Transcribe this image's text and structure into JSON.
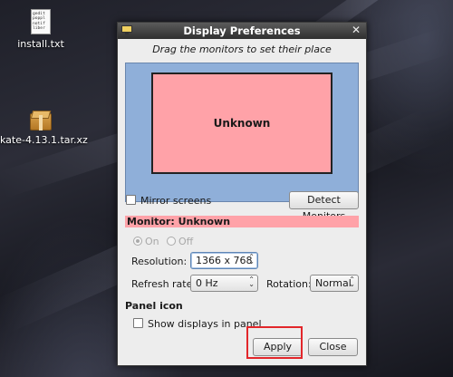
{
  "desktop": {
    "icons": [
      {
        "label": "install.txt",
        "preview_lines": [
          "gedit",
          "poppl",
          "notif",
          "liber"
        ]
      },
      {
        "label": "kate-4.13.1.tar.xz"
      }
    ]
  },
  "window": {
    "title": "Display Preferences",
    "subtitle": "Drag the monitors to set their place",
    "monitor_name": "Unknown",
    "mirror_label": "Mirror screens",
    "mirror_checked": false,
    "detect_button": "Detect Monitors",
    "monitor_heading": "Monitor: Unknown",
    "power": {
      "on": "On",
      "off": "Off",
      "selected": "On"
    },
    "resolution_label": "Resolution:",
    "resolution_value": "1366 x 768",
    "refresh_label": "Refresh rate:",
    "refresh_value": "0 Hz",
    "rotation_label": "Rotation:",
    "rotation_value": "Normal",
    "panel_section": "Panel icon",
    "panel_checkbox": "Show displays in panel",
    "apply_button": "Apply",
    "close_button": "Close"
  },
  "colors": {
    "monitor_fill": "#ffa2a8",
    "arrange_bg": "#8fafd9",
    "highlight_box": "#e2262a"
  }
}
